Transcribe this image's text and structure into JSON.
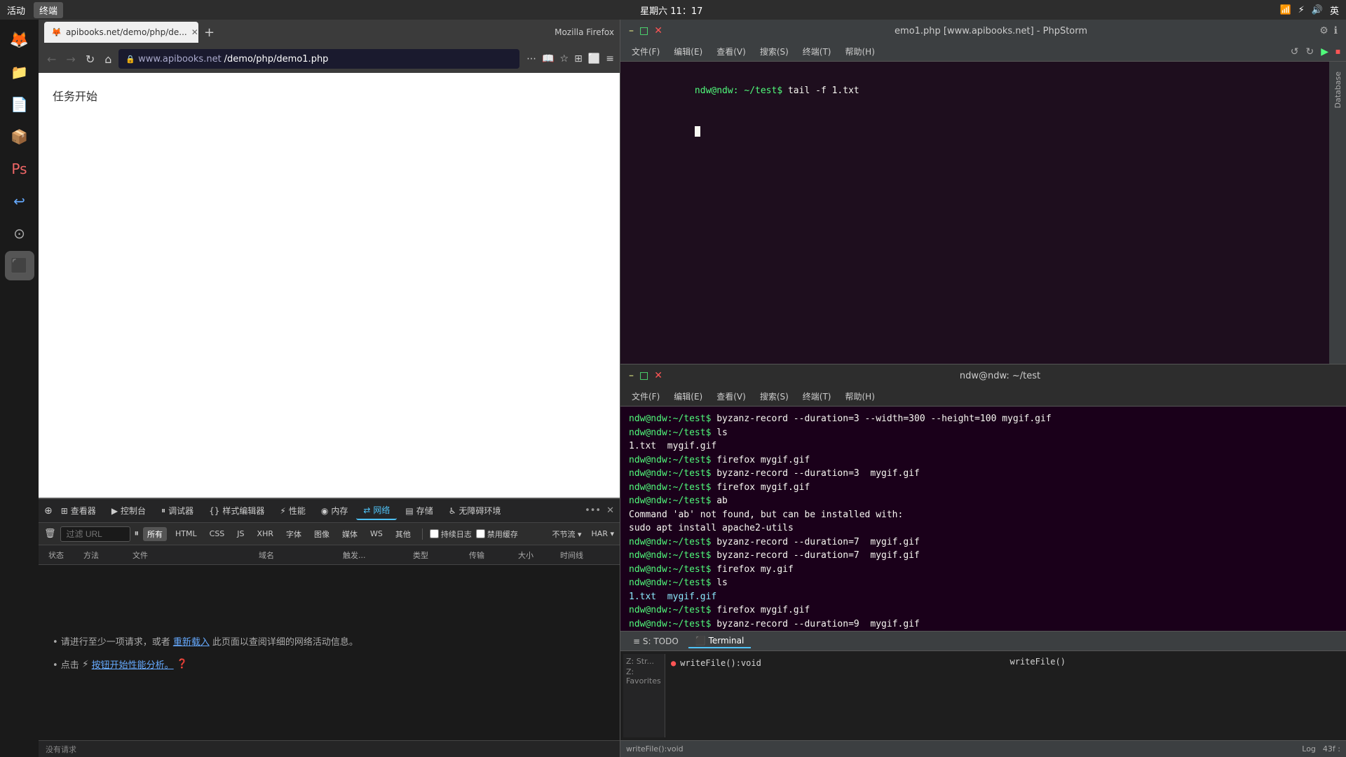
{
  "system": {
    "activities_label": "活动",
    "terminal_label": "终端",
    "datetime": "星期六 11：17",
    "lang": "英"
  },
  "firefox": {
    "title": "Mozilla Firefox",
    "tab_title": "apibooks.net/demo/php/de...",
    "tab_new_label": "+",
    "url": "www.apibooks.net/demo/php/demo1.php",
    "page_title": "任务开始",
    "nav_back": "←",
    "nav_forward": "→",
    "nav_refresh": "↻",
    "nav_home": "⌂"
  },
  "devtools": {
    "tabs": [
      {
        "label": "查看器",
        "icon": "⊞"
      },
      {
        "label": "控制台",
        "icon": "▶"
      },
      {
        "label": "调试器",
        "icon": "⏸"
      },
      {
        "label": "样式编辑器",
        "icon": "{}"
      },
      {
        "label": "性能",
        "icon": "⚡"
      },
      {
        "label": "内存",
        "icon": "◉"
      },
      {
        "label": "网络",
        "icon": "⇄"
      },
      {
        "label": "存储",
        "icon": "▤"
      },
      {
        "label": "无障碍环境",
        "icon": "♿"
      }
    ],
    "active_tab": "网络",
    "filter_placeholder": "过滤 URL",
    "filter_buttons": [
      "所有",
      "HTML",
      "CSS",
      "JS",
      "XHR",
      "字体",
      "图像",
      "媒体",
      "WS",
      "其他"
    ],
    "active_filter": "所有",
    "checkboxes": [
      "持续日志",
      "禁用缓存"
    ],
    "throttle_label": "不节流",
    "har_label": "HAR ▾",
    "columns": [
      "状态",
      "方法",
      "文件",
      "域名",
      "触发...",
      "类型",
      "传输",
      "大小",
      "时间线"
    ],
    "empty_hint1": "• 请进行至少一项请求，或者",
    "empty_hint1_link": "重新载入",
    "empty_hint1_suffix": "此页面以查阅详细的网络活动信息。",
    "empty_hint2_prefix": "• 点击",
    "empty_hint2_link": "按钮开始性能分析。",
    "status_label": "没有请求"
  },
  "phpstorm_top": {
    "title": "emo1.php [www.apibooks.net] - PhpStorm",
    "menus": [
      "文件(F)",
      "编辑(E)",
      "查看(V)",
      "搜索(S)",
      "终端(T)",
      "帮助(H)"
    ],
    "terminal_prompt": "ndw@ndw: ~/test",
    "command1": "tail -f 1.txt",
    "cursor": "█"
  },
  "terminal_bottom": {
    "title": "ndw@ndw: ~/test",
    "menus": [
      "文件(F)",
      "编辑(E)",
      "查看(V)",
      "搜索(S)",
      "终端(T)",
      "帮助(H)"
    ],
    "lines": [
      {
        "prompt": "ndw@ndw:~/test$ ",
        "cmd": "byzanz-record --duration=3 --width=300 --height=100 mygif.gif"
      },
      {
        "prompt": "ndw@ndw:~/test$ ",
        "cmd": "ls"
      },
      {
        "output": "1.txt  mygif.gif",
        "color": "white"
      },
      {
        "prompt": "ndw@ndw:~/test$ ",
        "cmd": "firefox mygif.gif"
      },
      {
        "prompt": "ndw@ndw:~/test$ ",
        "cmd": "byzanz-record --duration=3  mygif.gif"
      },
      {
        "prompt": "ndw@ndw:~/test$ ",
        "cmd": "firefox mygif.gif"
      },
      {
        "prompt": "ndw@ndw:~/test$ ",
        "cmd": "ab"
      },
      {
        "output": "",
        "color": "white"
      },
      {
        "output": "Command 'ab' not found, but can be installed with:",
        "color": "white"
      },
      {
        "output": "",
        "color": "white"
      },
      {
        "output": "sudo apt install apache2-utils",
        "color": "white"
      },
      {
        "output": "",
        "color": "white"
      },
      {
        "prompt": "ndw@ndw:~/test$ ",
        "cmd": "byzanz-record --duration=7  mygif.gif"
      },
      {
        "prompt": "ndw@ndw:~/test$ ",
        "cmd": "byzanz-record --duration=7  mygif.gif"
      },
      {
        "prompt": "ndw@ndw:~/test$ ",
        "cmd": "firefox my.gif"
      },
      {
        "prompt": "ndw@ndw:~/test$ ",
        "cmd": "ls"
      },
      {
        "output": "1.txt  mygif.gif",
        "color": "cyan"
      },
      {
        "prompt": "ndw@ndw:~/test$ ",
        "cmd": "firefox mygif.gif"
      },
      {
        "prompt": "ndw@ndw:~/test$ ",
        "cmd": "byzanz-record --duration=9  mygif.gif"
      },
      {
        "prompt": "",
        "cmd": ""
      }
    ]
  },
  "phpstorm_bottom": {
    "tabs": [
      "S: TODO",
      "Terminal"
    ],
    "active_tab": "Terminal",
    "code_content": "writeFile()",
    "statusbar_items": [
      "writeFile():void",
      "43f :"
    ]
  },
  "sidebar_icons": [
    {
      "name": "firefox-icon",
      "label": "🦊"
    },
    {
      "name": "files-icon",
      "label": "📁"
    },
    {
      "name": "text-icon",
      "label": "📄"
    },
    {
      "name": "code-icon",
      "label": "📦"
    },
    {
      "name": "ps-icon",
      "label": "🎨"
    },
    {
      "name": "arrow-icon",
      "label": "↩"
    },
    {
      "name": "circle-icon",
      "label": "⊙"
    },
    {
      "name": "terminal-icon",
      "label": "⬛"
    }
  ]
}
